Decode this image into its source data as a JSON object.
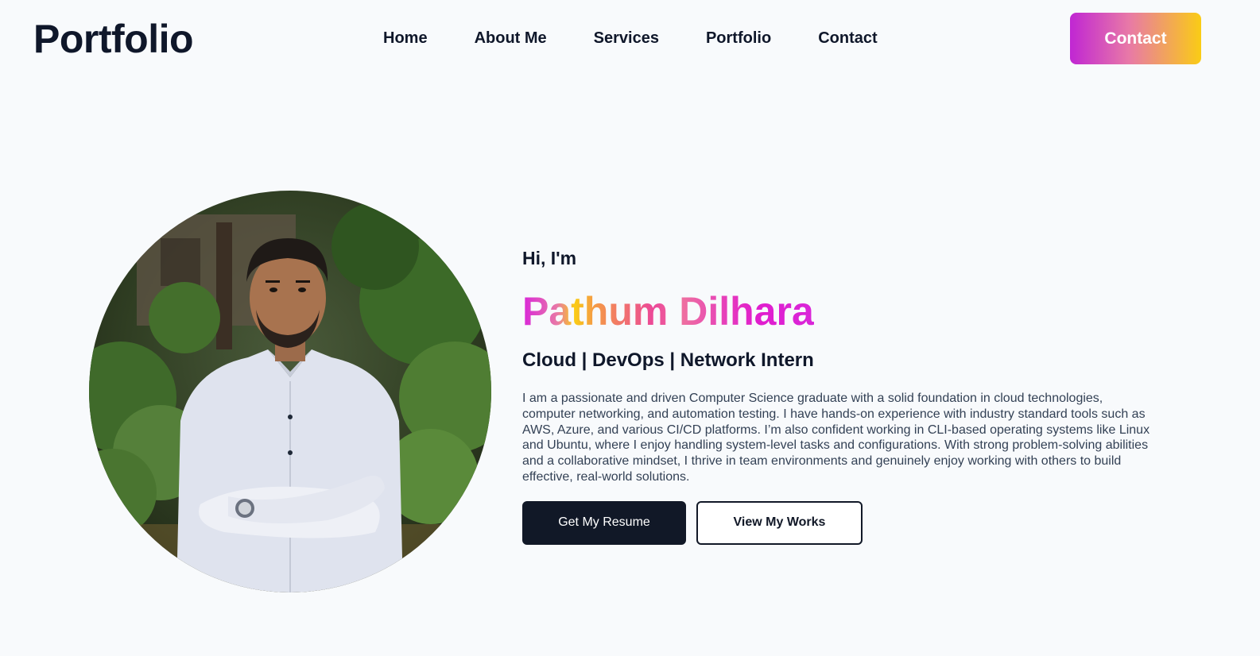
{
  "header": {
    "logo": "Portfolio",
    "nav": [
      "Home",
      "About Me",
      "Services",
      "Portfolio",
      "Contact"
    ],
    "contact_button": "Contact"
  },
  "hero": {
    "greeting": "Hi, I'm",
    "name": "Pathum Dilhara",
    "role": "Cloud | DevOps | Network Intern",
    "bio": "I am a passionate and driven Computer Science graduate with a solid foundation in cloud technologies, computer networking, and automation testing. I have hands-on experience with industry standard tools such as AWS, Azure, and various CI/CD platforms. I’m also confident working in CLI-based operating systems like Linux and Ubuntu, where I enjoy handling system-level tasks and configurations. With strong problem-solving abilities and a collaborative mindset, I thrive in team environments and genuinely enjoy working with others to build effective, real-world solutions.",
    "primary_button": "Get My Resume",
    "secondary_button": "View My Works"
  },
  "colors": {
    "background": "#f8fafc",
    "text": "#0f172a",
    "button_dark": "#111827",
    "gradient_start": "#c026d3",
    "gradient_end": "#facc15"
  }
}
